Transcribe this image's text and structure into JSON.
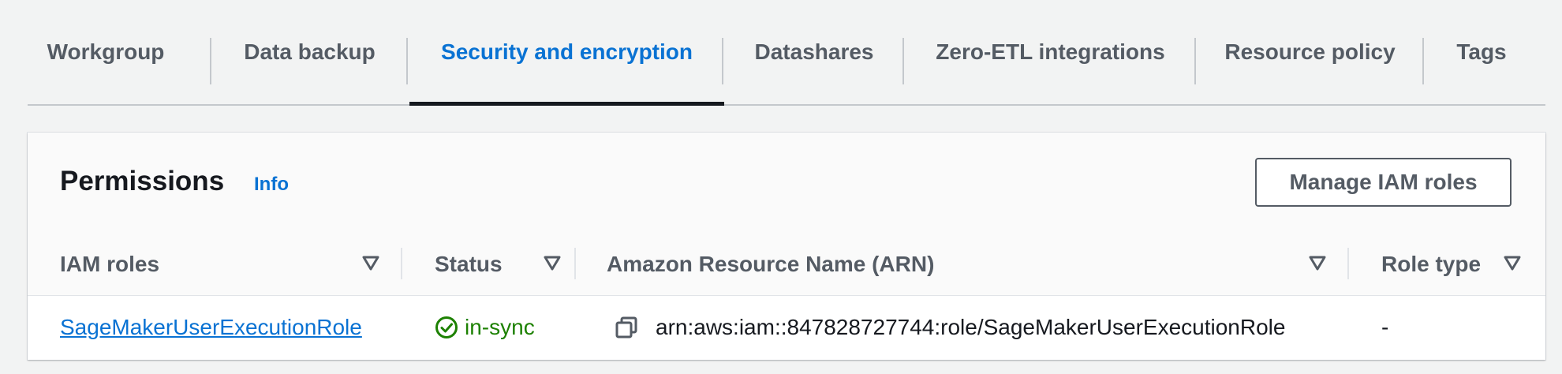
{
  "tabs": [
    {
      "label": "Workgroup",
      "active": false
    },
    {
      "label": "Data backup",
      "active": false
    },
    {
      "label": "Security and encryption",
      "active": true
    },
    {
      "label": "Datashares",
      "active": false
    },
    {
      "label": "Zero-ETL integrations",
      "active": false
    },
    {
      "label": "Resource policy",
      "active": false
    },
    {
      "label": "Tags",
      "active": false
    }
  ],
  "permissions": {
    "title": "Permissions",
    "info_label": "Info",
    "manage_button_label": "Manage IAM roles",
    "columns": [
      "IAM roles",
      "Status",
      "Amazon Resource Name (ARN)",
      "Role type"
    ],
    "rows": [
      {
        "role": "SageMakerUserExecutionRole",
        "status": "in-sync",
        "arn": "arn:aws:iam::847828727744:role/SageMakerUserExecutionRole",
        "role_type": "-"
      }
    ]
  },
  "icons": {
    "sort": "sort-filter-icon",
    "status": "check-circle-icon",
    "copy": "copy-icon"
  },
  "colors": {
    "accent": "#0972d3",
    "success": "#1d8102",
    "text": "#16191f",
    "muted": "#545b64",
    "background": "#f2f3f3"
  }
}
